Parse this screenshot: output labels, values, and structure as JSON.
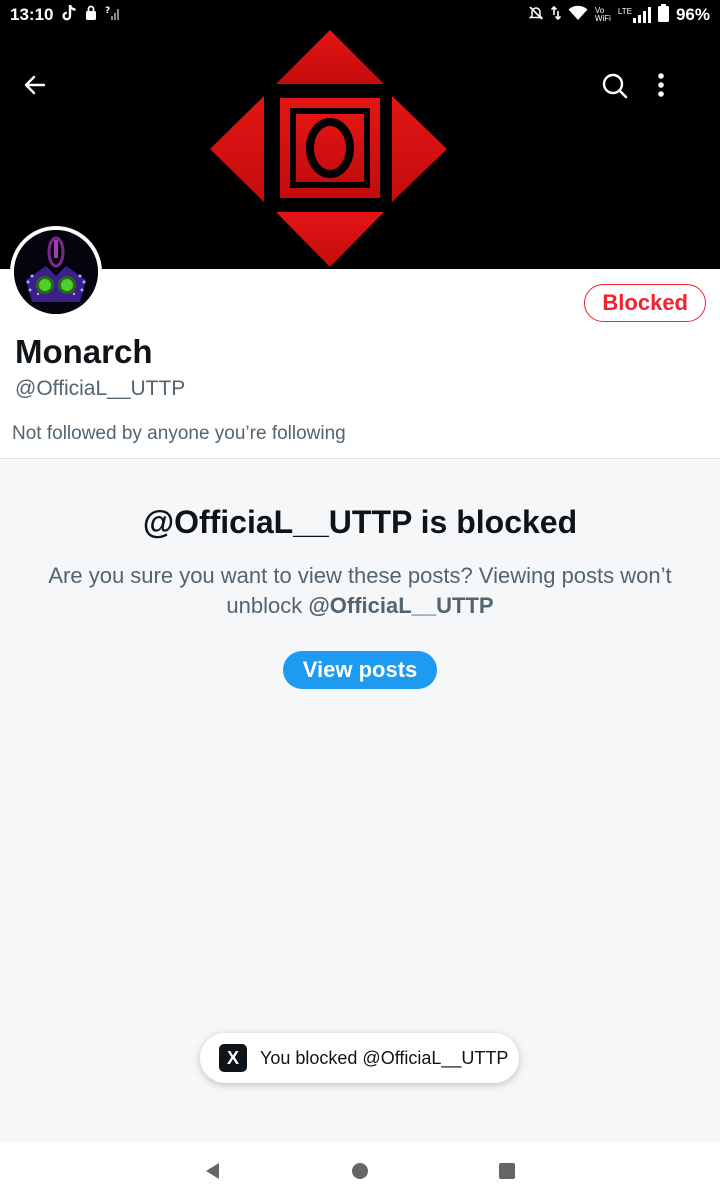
{
  "status_bar": {
    "time": "13:10",
    "battery": "96%",
    "network_label_top": "Vo",
    "network_label_bottom": "WiFi",
    "lte_label": "LTE"
  },
  "top_bar": {
    "back_icon": "arrow-left-icon",
    "search_icon": "search-icon",
    "more_icon": "more-vertical-icon"
  },
  "profile": {
    "display_name": "Monarch",
    "handle": "@OfficiaL__UTTP",
    "followed_note": "Not followed by anyone you’re following",
    "blocked_label": "Blocked",
    "banner_logo_letter": "O"
  },
  "blocked_notice": {
    "title": "@OfficiaL__UTTP is blocked",
    "body_prefix": "Are you sure you want to view these posts? Viewing posts won’t unblock ",
    "body_handle": "@OfficiaL__UTTP",
    "view_button": "View posts"
  },
  "toast": {
    "logo": "X",
    "text": "You blocked @OfficiaL__UTTP"
  },
  "colors": {
    "accent": "#1d9bf0",
    "blocked_red": "#f4212e",
    "banner_red": "#e01010"
  }
}
